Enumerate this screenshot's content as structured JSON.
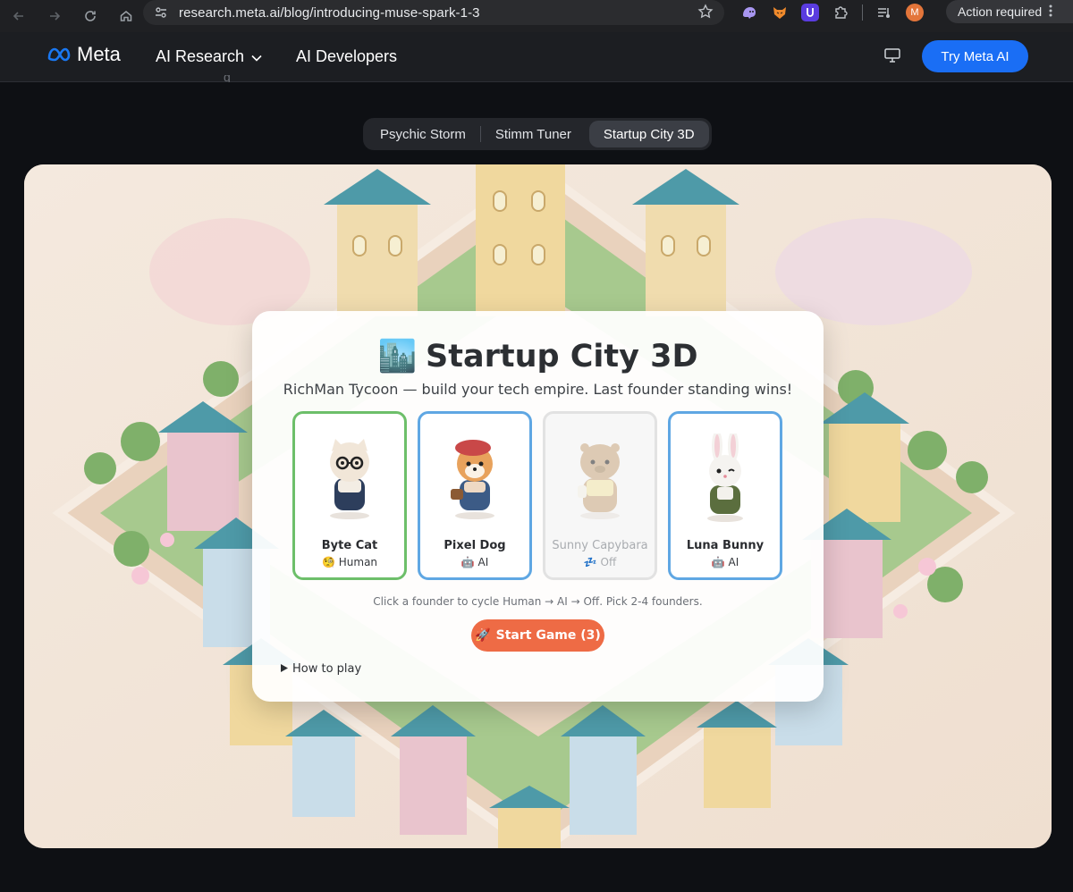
{
  "browser": {
    "url": "research.meta.ai/blog/introducing-muse-spark-1-3",
    "profile_initial": "M",
    "action_label": "Action required",
    "icons": [
      "back-icon",
      "forward-icon",
      "reload-icon",
      "home-icon",
      "site-info-icon",
      "bookmark-star-icon",
      "extension-puzzle-icon",
      "media-control-icon",
      "kebab-menu-icon"
    ]
  },
  "header": {
    "logo_text": "Meta",
    "nav": [
      {
        "label": "AI Research",
        "has_dropdown": true
      },
      {
        "label": "AI Developers",
        "has_dropdown": false
      }
    ],
    "cta_label": "Try Meta AI"
  },
  "tabs": [
    {
      "label": "Psychic Storm",
      "active": false
    },
    {
      "label": "Stimm Tuner",
      "active": false
    },
    {
      "label": "Startup City 3D",
      "active": true
    }
  ],
  "game": {
    "title_icon": "🏙️",
    "title": "Startup City 3D",
    "subtitle": "RichMan Tycoon — build your tech empire. Last founder standing wins!",
    "founders": [
      {
        "name": "Byte Cat",
        "role_icon": "🧐",
        "role": "Human",
        "state": "human"
      },
      {
        "name": "Pixel Dog",
        "role_icon": "🤖",
        "role": "AI",
        "state": "ai"
      },
      {
        "name": "Sunny Capybara",
        "role_icon": "💤",
        "role": "Off",
        "state": "off"
      },
      {
        "name": "Luna Bunny",
        "role_icon": "🤖",
        "role": "AI",
        "state": "ai"
      }
    ],
    "hint": "Click a founder to cycle Human → AI → Off. Pick 2-4 founders.",
    "start_icon": "🚀",
    "start_label": "Start Game (3)",
    "how_to_play": "How to play"
  },
  "colors": {
    "accent_blue": "#1a6ef5",
    "human_border": "#6dbf6a",
    "ai_border": "#5fa7e3",
    "start_button": "#ee6b45"
  }
}
